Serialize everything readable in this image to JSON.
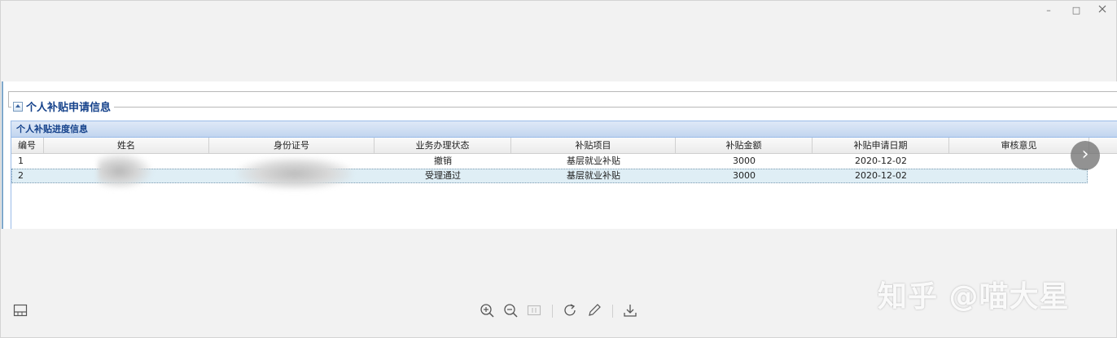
{
  "window": {
    "minimize": "–",
    "maximize": "□"
  },
  "section": {
    "title": "个人补贴申请信息"
  },
  "grid": {
    "title": "个人补贴进度信息",
    "columns": [
      "编号",
      "姓名",
      "身份证号",
      "业务办理状态",
      "补贴项目",
      "补贴金额",
      "补贴申请日期",
      "审核意见"
    ],
    "rows": [
      {
        "no": "1",
        "name": "",
        "id_number": "",
        "status": "撤销",
        "project": "基层就业补贴",
        "amount": "3000",
        "date": "2020-12-02",
        "opinion": ""
      },
      {
        "no": "2",
        "name": "",
        "id_number": "",
        "status": "受理通过",
        "project": "基层就业补贴",
        "amount": "3000",
        "date": "2020-12-02",
        "opinion": ""
      }
    ]
  },
  "viewer": {
    "next": "›",
    "tools": [
      "zoom-in-icon",
      "zoom-out-icon",
      "fit-page-icon",
      "rotate-icon",
      "edit-icon",
      "download-icon"
    ]
  },
  "watermark": "知乎 @喵大星"
}
